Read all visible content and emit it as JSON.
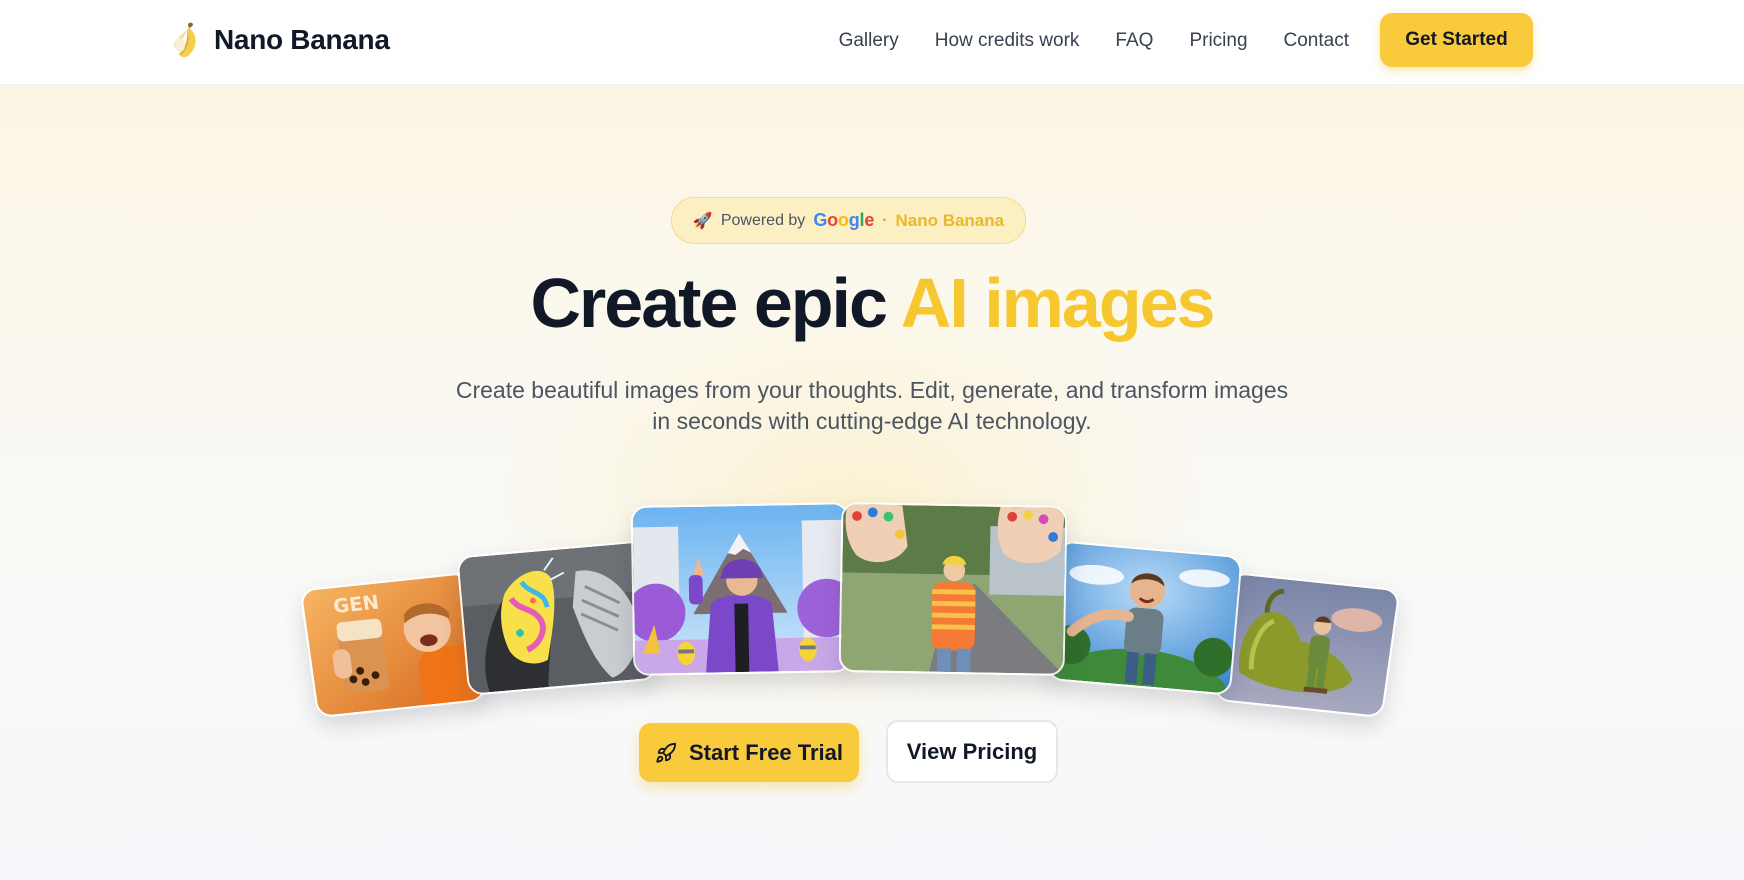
{
  "header": {
    "brand": {
      "name": "Nano Banana",
      "icon": "banana-icon"
    },
    "nav": [
      {
        "label": "Gallery"
      },
      {
        "label": "How credits work"
      },
      {
        "label": "FAQ"
      },
      {
        "label": "Pricing"
      },
      {
        "label": "Contact"
      }
    ],
    "cta_label": "Get Started"
  },
  "hero": {
    "badge": {
      "icon": "rocket-icon",
      "prefix": "Powered by",
      "google_letters": [
        "G",
        "o",
        "o",
        "g",
        "l",
        "e"
      ],
      "separator": "·",
      "product": "Nano Banana"
    },
    "headline": {
      "dark": "Create epic",
      "accent": "AI images"
    },
    "subtitle": "Create beautiful images from your thoughts. Edit, generate, and transform images in seconds with cutting-edge AI technology.",
    "gallery": [
      {
        "name": "gallery-image-bubble-tea",
        "overlay_text": "GEN"
      },
      {
        "name": "gallery-image-painted-sneakers"
      },
      {
        "name": "gallery-image-purple-jacket-street"
      },
      {
        "name": "gallery-image-painted-hands"
      },
      {
        "name": "gallery-image-fisheye-selfie"
      },
      {
        "name": "gallery-image-giant-pepper"
      }
    ],
    "primary_cta": {
      "label": "Start Free Trial",
      "icon": "rocket-icon"
    },
    "secondary_cta": {
      "label": "View Pricing"
    }
  },
  "colors": {
    "accent": "#f8ca3c",
    "headline_accent": "#f7c730",
    "text_dark": "#111827",
    "text_muted": "#4b5563"
  }
}
